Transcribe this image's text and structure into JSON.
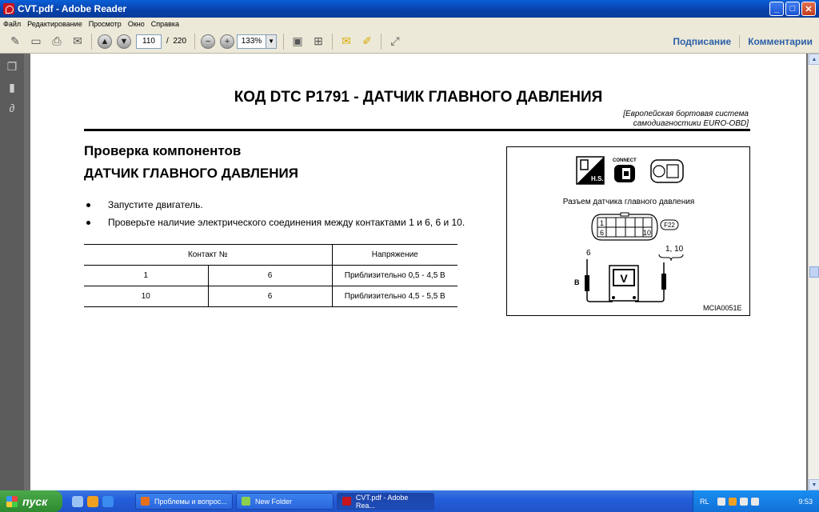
{
  "window": {
    "title": "CVT.pdf - Adobe Reader",
    "btn_minimize": "_",
    "btn_maximize": "□",
    "btn_close": "✕"
  },
  "menubar": {
    "items": [
      "Файл",
      "Редактирование",
      "Просмотр",
      "Окно",
      "Справка"
    ]
  },
  "toolbar": {
    "page_current": "110",
    "page_separator": "/",
    "page_total": "220",
    "zoom": "133%",
    "sign_label": "Подписание",
    "comments_label": "Комментарии"
  },
  "document": {
    "title": "КОД DTC P1791 - ДАТЧИК ГЛАВНОГО ДАВЛЕНИЯ",
    "subtitle_line1": "[Европейская бортовая система",
    "subtitle_line2": "самодиагностики EURO-OBD]",
    "heading1": "Проверка компонентов",
    "heading2": "ДАТЧИК ГЛАВНОГО ДАВЛЕНИЯ",
    "bullets": [
      "Запустите двигатель.",
      "Проверьте наличие электрического соединения между контактами 1 и 6, 6 и 10."
    ],
    "table": {
      "header_contact": "Контакт №",
      "header_voltage": "Напряжение",
      "rows": [
        {
          "a": "1",
          "b": "6",
          "v": "Приблизительно 0,5 - 4,5 В"
        },
        {
          "a": "10",
          "b": "6",
          "v": "Приблизительно 4,5 - 5,5 В"
        }
      ]
    },
    "diagram": {
      "hs_label": "H.S.",
      "connect_label": "CONNECT",
      "connector_caption": "Разъем датчика главного давления",
      "pin_1": "1",
      "pin_6": "6",
      "pin_10": "10",
      "connector_id": "F22",
      "probe_left": "6",
      "probe_right": "1, 10",
      "wire_letter": "B",
      "meter_letter": "V",
      "figure_code": "MCIA0051E"
    }
  },
  "taskbar": {
    "start_label": "пуск",
    "tasks": [
      {
        "label": "Проблемы и вопрос...",
        "color": "#e8701c"
      },
      {
        "label": "New Folder",
        "color": "#8ccf4c"
      },
      {
        "label": "CVT.pdf - Adobe Rea...",
        "color": "#c8141c"
      }
    ],
    "language": "RL",
    "clock": "9:53"
  }
}
